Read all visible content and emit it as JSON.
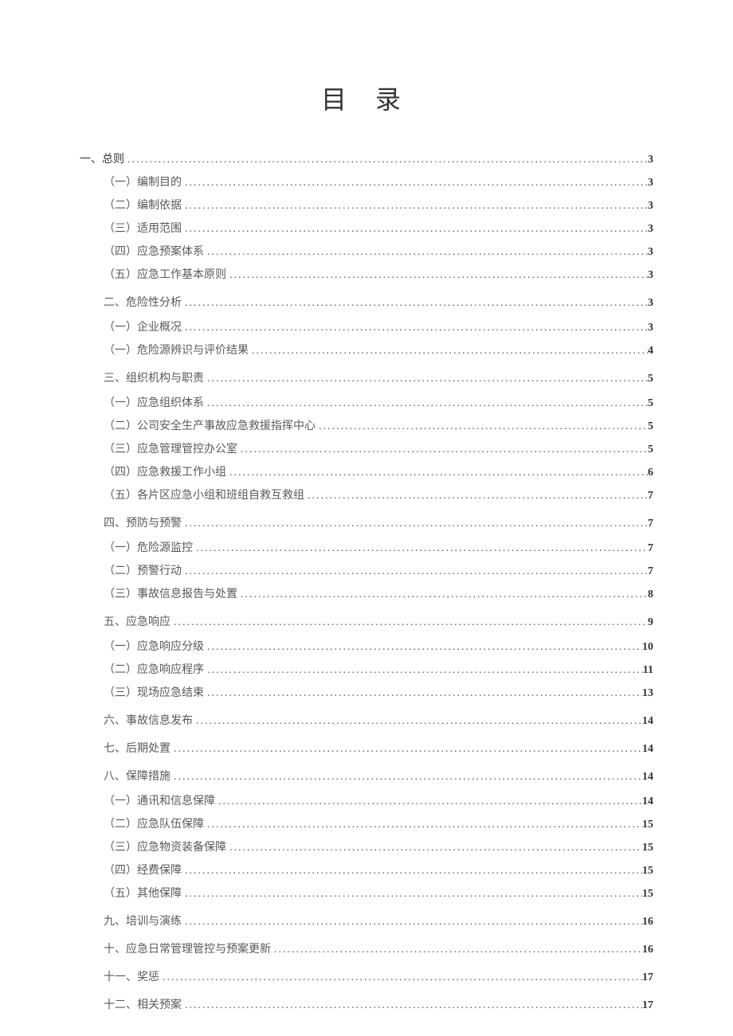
{
  "title": "目 录",
  "toc": [
    {
      "label": "一、总则",
      "page": "3",
      "level": 1,
      "section": false
    },
    {
      "label": "（一）编制目的",
      "page": "3",
      "level": 2,
      "section": false
    },
    {
      "label": "（二）编制依据",
      "page": "3",
      "level": 2,
      "section": false
    },
    {
      "label": "（三）适用范围",
      "page": "3",
      "level": 2,
      "section": false
    },
    {
      "label": "（四）应急预案体系",
      "page": "3",
      "level": 2,
      "section": false
    },
    {
      "label": "（五）应急工作基本原则",
      "page": "3",
      "level": 2,
      "section": false
    },
    {
      "label": "二、危险性分析",
      "page": "3",
      "level": 2,
      "section": true
    },
    {
      "label": "（一）企业概况",
      "page": "3",
      "level": 2,
      "section": false
    },
    {
      "label": "（一）危险源辨识与评价结果",
      "page": "4",
      "level": 2,
      "section": false
    },
    {
      "label": "三、组织机构与职责",
      "page": "5",
      "level": 2,
      "section": true
    },
    {
      "label": "（一）应急组织体系",
      "page": "5",
      "level": 2,
      "section": false
    },
    {
      "label": "（二）公司安全生产事故应急救援指挥中心",
      "page": "5",
      "level": 2,
      "section": false
    },
    {
      "label": "（三）应急管理管控办公室",
      "page": "5",
      "level": 2,
      "section": false
    },
    {
      "label": "（四）应急救援工作小组",
      "page": "6",
      "level": 2,
      "section": false
    },
    {
      "label": "（五）各片区应急小组和班组自救互救组",
      "page": "7",
      "level": 2,
      "section": false
    },
    {
      "label": "四、预防与预警",
      "page": "7",
      "level": 2,
      "section": true
    },
    {
      "label": "（一）危险源监控",
      "page": "7",
      "level": 2,
      "section": false
    },
    {
      "label": "（二）预警行动",
      "page": "7",
      "level": 2,
      "section": false
    },
    {
      "label": "（三）事故信息报告与处置",
      "page": "8",
      "level": 2,
      "section": false
    },
    {
      "label": "五、应急响应",
      "page": "9",
      "level": 2,
      "section": true
    },
    {
      "label": "（一）应急响应分级",
      "page": "10",
      "level": 2,
      "section": false
    },
    {
      "label": "（二）应急响应程序",
      "page": "11",
      "level": 2,
      "section": false
    },
    {
      "label": "（三）现场应急结束",
      "page": "13",
      "level": 2,
      "section": false
    },
    {
      "label": "六、事故信息发布",
      "page": "14",
      "level": 2,
      "section": true
    },
    {
      "label": "七、后期处置",
      "page": "14",
      "level": 2,
      "section": true
    },
    {
      "label": "八、保障措施",
      "page": "14",
      "level": 2,
      "section": true
    },
    {
      "label": "（一）通讯和信息保障",
      "page": "14",
      "level": 2,
      "section": false
    },
    {
      "label": "（二）应急队伍保障",
      "page": "15",
      "level": 2,
      "section": false
    },
    {
      "label": "（三）应急物资装备保障",
      "page": "15",
      "level": 2,
      "section": false
    },
    {
      "label": "（四）经费保障",
      "page": "15",
      "level": 2,
      "section": false
    },
    {
      "label": "（五）其他保障",
      "page": "15",
      "level": 2,
      "section": false
    },
    {
      "label": "九、培训与演练",
      "page": "16",
      "level": 2,
      "section": true
    },
    {
      "label": "十、应急日常管理管控与预案更新",
      "page": "16",
      "level": 2,
      "section": true
    },
    {
      "label": "十一、奖惩",
      "page": "17",
      "level": 2,
      "section": true
    },
    {
      "label": "十二、相关预案",
      "page": "17",
      "level": 2,
      "section": true
    }
  ]
}
